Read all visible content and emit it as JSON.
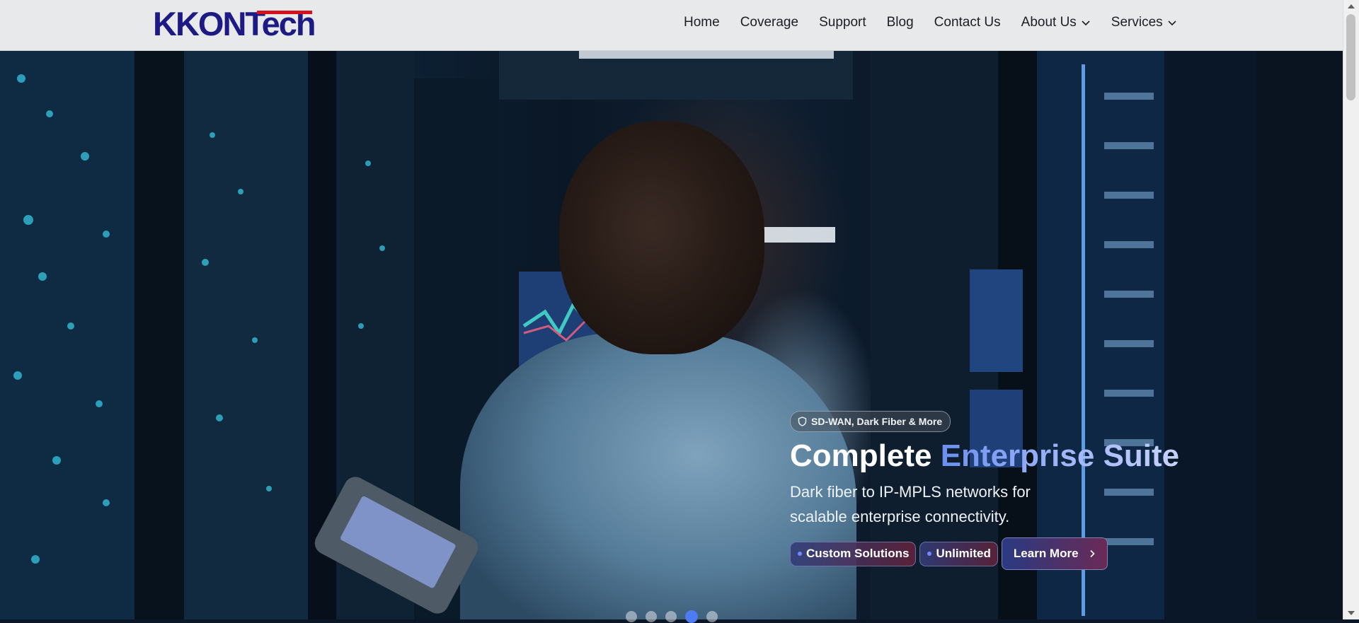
{
  "header": {
    "logo_text": "KKONTech",
    "nav": [
      {
        "label": "Home",
        "has_dropdown": false
      },
      {
        "label": "Coverage",
        "has_dropdown": false
      },
      {
        "label": "Support",
        "has_dropdown": false
      },
      {
        "label": "Blog",
        "has_dropdown": false
      },
      {
        "label": "Contact Us",
        "has_dropdown": false
      },
      {
        "label": "About Us",
        "has_dropdown": true
      },
      {
        "label": "Services",
        "has_dropdown": true
      }
    ]
  },
  "hero": {
    "badge": "SD-WAN, Dark Fiber & More",
    "badge_icon": "shield-icon",
    "title_plain": "Complete ",
    "title_accent": "Enterprise Suite",
    "subtitle": "Dark fiber to IP-MPLS networks for scalable enterprise connectivity.",
    "chips": [
      "Custom Solutions",
      "Unlimited"
    ],
    "cta_label": "Learn More",
    "carousel": {
      "count": 5,
      "active_index": 3
    }
  },
  "colors": {
    "logo": "#1d1a86",
    "logo_accent": "#d3121e",
    "accent_gradient_start": "#6b8ff0",
    "carousel_active": "#4d7cf2"
  }
}
